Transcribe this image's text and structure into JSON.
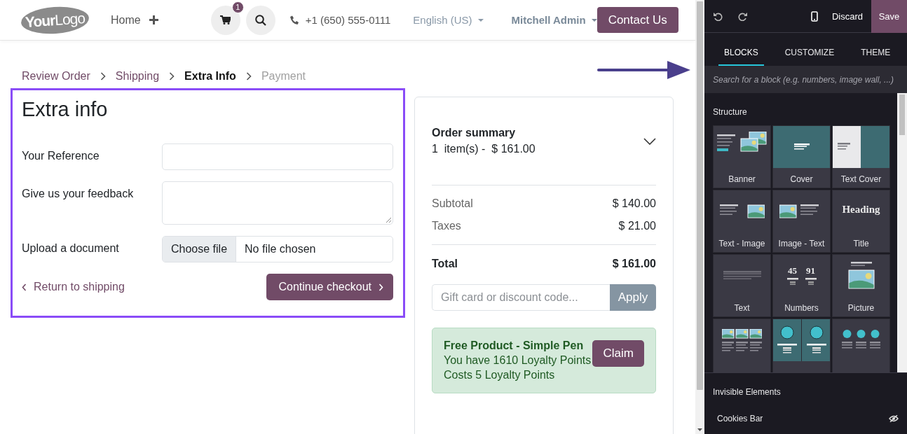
{
  "header": {
    "logo": "**Your**Logo",
    "nav": [
      {
        "label": "Home"
      }
    ],
    "cart_count": "1",
    "phone": "+1 (650) 555-0111",
    "language": "English (US)",
    "user": "Mitchell Admin",
    "contact_button": "Contact Us"
  },
  "breadcrumb": [
    {
      "label": "Review Order",
      "selected": false,
      "disabled": false
    },
    {
      "label": "Shipping",
      "selected": false,
      "disabled": false
    },
    {
      "label": "Extra Info",
      "selected": true,
      "disabled": false
    },
    {
      "label": "Payment",
      "selected": false,
      "disabled": true
    }
  ],
  "form": {
    "title": "Extra info",
    "fields": [
      {
        "kind": "input",
        "label": "Your Reference"
      },
      {
        "kind": "textarea",
        "label": "Give us your feedback"
      },
      {
        "kind": "file",
        "label": "Upload a document",
        "button": "Choose file",
        "value": "No file chosen"
      }
    ],
    "back_link": "Return to shipping",
    "continue_button": "Continue checkout"
  },
  "summary": {
    "title": "Order summary",
    "items_line": "1  item(s) -  $ 161.00",
    "expanded": false,
    "lines": [
      {
        "label": "Subtotal",
        "value": "$ 140.00"
      },
      {
        "label": "Taxes",
        "value": "$ 21.00"
      }
    ],
    "total": {
      "label": "Total",
      "value": "$ 161.00"
    },
    "promo": {
      "placeholder": "Gift card or discount code...",
      "button": "Apply"
    },
    "reward": {
      "title": "Free Product - Simple Pen",
      "lines": [
        "You have 1610 Loyalty Points",
        "Costs 5 Loyalty Points"
      ],
      "button": "Claim"
    }
  },
  "editor": {
    "discard": "Discard",
    "save": "Save",
    "tabs": [
      {
        "label": "BLOCKS",
        "selected": true
      },
      {
        "label": "CUSTOMIZE",
        "selected": false
      },
      {
        "label": "THEME",
        "selected": false
      }
    ],
    "search_placeholder": "Search for a block (e.g. numbers, image wall, ...)",
    "section": "Structure",
    "blocks": [
      {
        "kind": "banner",
        "label": "Banner"
      },
      {
        "kind": "cover",
        "label": "Cover"
      },
      {
        "kind": "text-cover",
        "label": "Text Cover"
      },
      {
        "kind": "text-image",
        "label": "Text - Image"
      },
      {
        "kind": "image-text",
        "label": "Image - Text"
      },
      {
        "kind": "title",
        "label": "Title",
        "preview_text": "Heading"
      },
      {
        "kind": "text",
        "label": "Text"
      },
      {
        "kind": "numbers",
        "label": "Numbers",
        "preview_numbers": [
          "45",
          "91"
        ]
      },
      {
        "kind": "picture",
        "label": "Picture"
      },
      {
        "kind": "columns"
      },
      {
        "kind": "big-boxes"
      },
      {
        "kind": "features"
      }
    ],
    "invisible_title": "Invisible Elements",
    "invisible": [
      {
        "label": "Cookies Bar",
        "visible": false
      }
    ]
  }
}
